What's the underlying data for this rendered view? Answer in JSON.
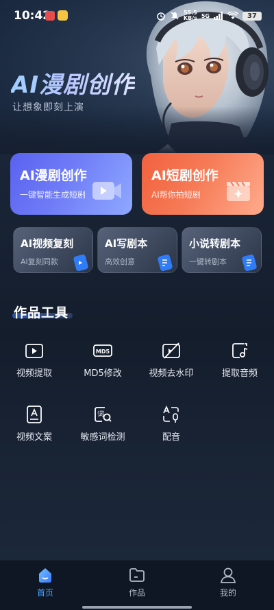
{
  "status_bar": {
    "time": "10:42",
    "net_speed_value": "55.5",
    "net_speed_unit": "KB/s",
    "network": "5G",
    "battery": "37"
  },
  "hero": {
    "title": "AI漫剧创作",
    "subtitle": "让想象即刻上演"
  },
  "feature_cards": [
    {
      "title": "AI漫剧创作",
      "subtitle": "一键智能生成短剧",
      "accent": "#5a62f0",
      "icon": "video-play-icon"
    },
    {
      "title": "AI短剧创作",
      "subtitle": "AI帮你拍短剧",
      "accent": "#f2613f",
      "icon": "clapperboard-icon"
    }
  ],
  "mini_cards": [
    {
      "title": "AI视频复刻",
      "subtitle": "AI复刻同款",
      "icon": "blue-tag-icon"
    },
    {
      "title": "AI写剧本",
      "subtitle": "高效创意",
      "icon": "blue-tag-icon"
    },
    {
      "title": "小说转剧本",
      "subtitle": "一键转剧本",
      "icon": "blue-tag-icon"
    }
  ],
  "tools_section": {
    "title": "作品工具",
    "tools": [
      {
        "label": "视频提取",
        "icon": "video-extract-icon"
      },
      {
        "label": "MD5修改",
        "icon": "md5-icon"
      },
      {
        "label": "视频去水印",
        "icon": "remove-watermark-icon"
      },
      {
        "label": "提取音频",
        "icon": "extract-audio-icon"
      },
      {
        "label": "视频文案",
        "icon": "video-copywriting-icon"
      },
      {
        "label": "敏感词检测",
        "icon": "sensitive-word-icon"
      },
      {
        "label": "配音",
        "icon": "dubbing-icon"
      }
    ]
  },
  "bottom_nav": {
    "items": [
      {
        "label": "首页",
        "icon": "home-icon",
        "active": true
      },
      {
        "label": "作品",
        "icon": "folder-icon",
        "active": false
      },
      {
        "label": "我的",
        "icon": "profile-icon",
        "active": false
      }
    ],
    "active_color": "#4aa3ff",
    "inactive_color": "#b3bac6"
  }
}
